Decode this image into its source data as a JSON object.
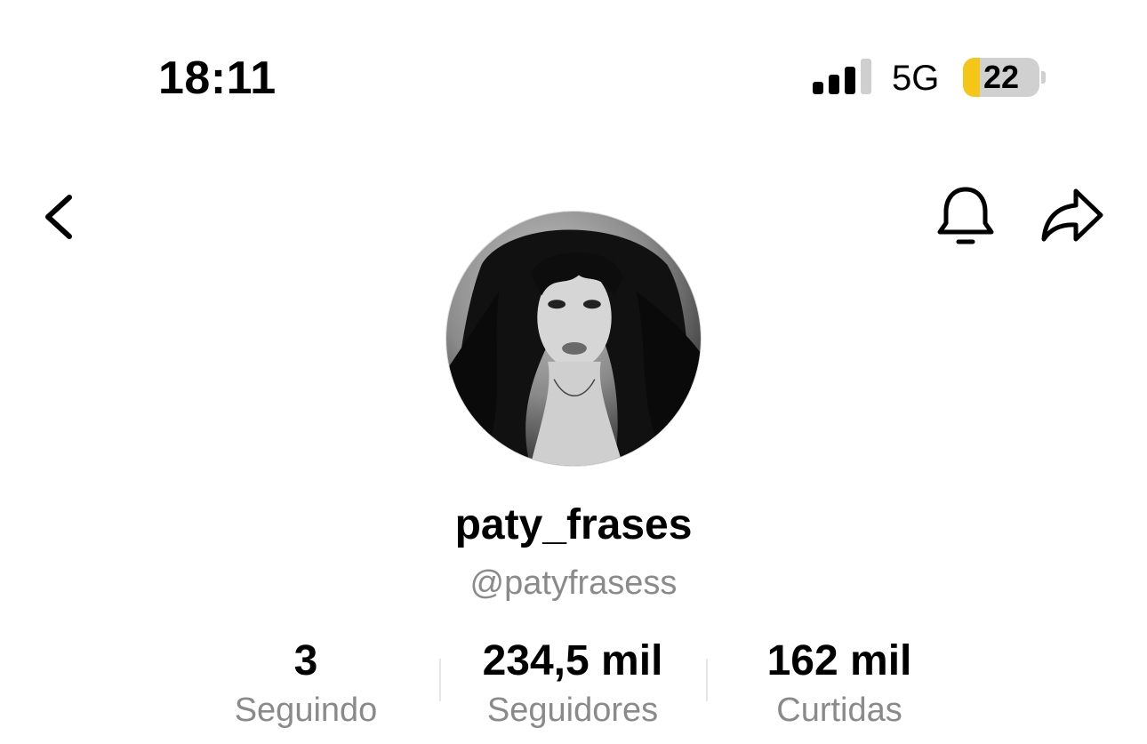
{
  "status_bar": {
    "time": "18:11",
    "network": "5G",
    "battery_level": "22",
    "battery_fraction": 0.22,
    "signal_bars": 3
  },
  "nav": {
    "back_icon": "chevron-left-icon",
    "notification_icon": "bell-icon",
    "share_icon": "share-arrow-icon"
  },
  "profile": {
    "display_name": "paty_frases",
    "username": "@patyfrasess",
    "avatar": "profile-photo"
  },
  "stats": [
    {
      "value": "3",
      "label": "Seguindo"
    },
    {
      "value": "234,5 mil",
      "label": "Seguidores"
    },
    {
      "value": "162 mil",
      "label": "Curtidas"
    }
  ],
  "colors": {
    "battery_fill": "#f5c518",
    "secondary_text": "#8a8a8a"
  }
}
